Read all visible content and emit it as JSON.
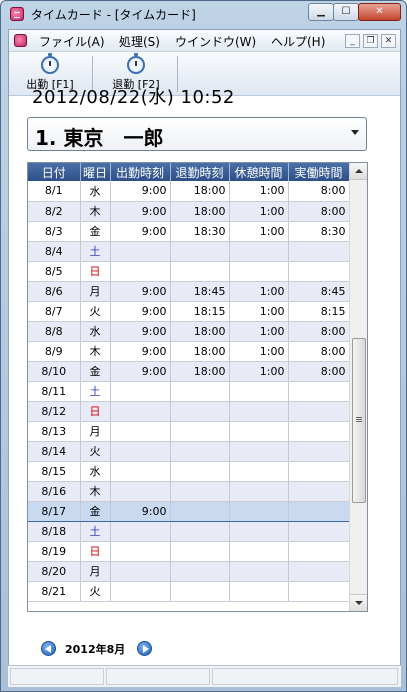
{
  "window": {
    "title": "タイムカード - [タイムカード]"
  },
  "menu": [
    "ファイル(A)",
    "処理(S)",
    "ウインドウ(W)",
    "ヘルプ(H)"
  ],
  "toolbar": {
    "clock_in_label": "出勤 [F1]",
    "clock_out_label": "退勤 [F2]"
  },
  "datetime": "2012/08/22(水) 10:52",
  "employee": "1. 東京　一郎",
  "grid": {
    "headers": [
      "日付",
      "曜日",
      "出勤時刻",
      "退勤時刻",
      "休憩時間",
      "実働時間"
    ],
    "rows": [
      [
        "8/1",
        "水",
        "9:00",
        "18:00",
        "1:00",
        "8:00"
      ],
      [
        "8/2",
        "木",
        "9:00",
        "18:00",
        "1:00",
        "8:00"
      ],
      [
        "8/3",
        "金",
        "9:00",
        "18:30",
        "1:00",
        "8:30"
      ],
      [
        "8/4",
        "土",
        "",
        "",
        "",
        ""
      ],
      [
        "8/5",
        "日",
        "",
        "",
        "",
        ""
      ],
      [
        "8/6",
        "月",
        "9:00",
        "18:45",
        "1:00",
        "8:45"
      ],
      [
        "8/7",
        "火",
        "9:00",
        "18:15",
        "1:00",
        "8:15"
      ],
      [
        "8/8",
        "水",
        "9:00",
        "18:00",
        "1:00",
        "8:00"
      ],
      [
        "8/9",
        "木",
        "9:00",
        "18:00",
        "1:00",
        "8:00"
      ],
      [
        "8/10",
        "金",
        "9:00",
        "18:00",
        "1:00",
        "8:00"
      ],
      [
        "8/11",
        "土",
        "",
        "",
        "",
        ""
      ],
      [
        "8/12",
        "日",
        "",
        "",
        "",
        ""
      ],
      [
        "8/13",
        "月",
        "",
        "",
        "",
        ""
      ],
      [
        "8/14",
        "火",
        "",
        "",
        "",
        ""
      ],
      [
        "8/15",
        "水",
        "",
        "",
        "",
        ""
      ],
      [
        "8/16",
        "木",
        "",
        "",
        "",
        ""
      ],
      [
        "8/17",
        "金",
        "9:00",
        "",
        "",
        ""
      ],
      [
        "8/18",
        "土",
        "",
        "",
        "",
        ""
      ],
      [
        "8/19",
        "日",
        "",
        "",
        "",
        ""
      ],
      [
        "8/20",
        "月",
        "",
        "",
        "",
        ""
      ],
      [
        "8/21",
        "火",
        "",
        "",
        "",
        ""
      ]
    ],
    "selected_row": "8/17"
  },
  "month_label": "2012年8月",
  "colors": {
    "saturday": "#2d3fb5",
    "sunday": "#d80000",
    "header": "#2c4f86",
    "alt_row": "#e8eaf6",
    "selected_row": "#c9d9ef"
  },
  "icons": {
    "app": "timecard-app-icon",
    "clock_in": "stopwatch-icon",
    "clock_out": "stopwatch-icon",
    "prev": "left-arrow-circle-icon",
    "next": "right-arrow-circle-icon"
  }
}
